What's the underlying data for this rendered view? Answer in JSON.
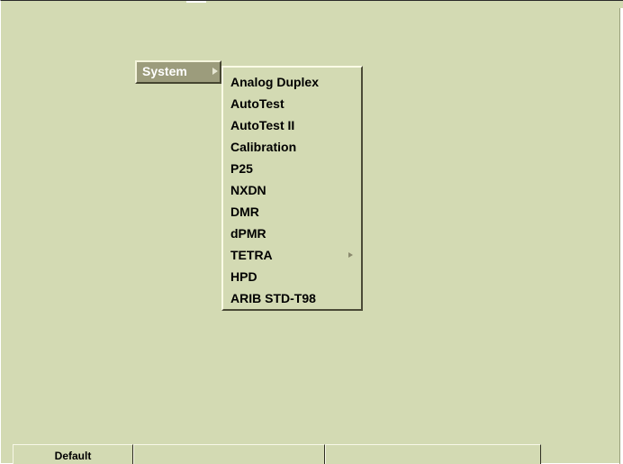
{
  "system_menu": {
    "label": "System",
    "arrow_icon": "submenu-arrow-right"
  },
  "submenu": {
    "items": [
      {
        "label": "Analog Duplex",
        "has_submenu": false
      },
      {
        "label": "AutoTest",
        "has_submenu": false
      },
      {
        "label": "AutoTest II",
        "has_submenu": false
      },
      {
        "label": "Calibration",
        "has_submenu": false
      },
      {
        "label": "P25",
        "has_submenu": false
      },
      {
        "label": "NXDN",
        "has_submenu": false
      },
      {
        "label": "DMR",
        "has_submenu": false
      },
      {
        "label": "dPMR",
        "has_submenu": false
      },
      {
        "label": "TETRA",
        "has_submenu": true
      },
      {
        "label": "HPD",
        "has_submenu": false
      },
      {
        "label": "ARIB STD-T98",
        "has_submenu": false
      }
    ]
  },
  "statusbar": {
    "cells": [
      "Default",
      "",
      ""
    ]
  },
  "colors": {
    "background": "#d3dab3",
    "menu_highlight": "#9c9c7c",
    "text": "#000000",
    "highlight_text": "#ffffff"
  }
}
